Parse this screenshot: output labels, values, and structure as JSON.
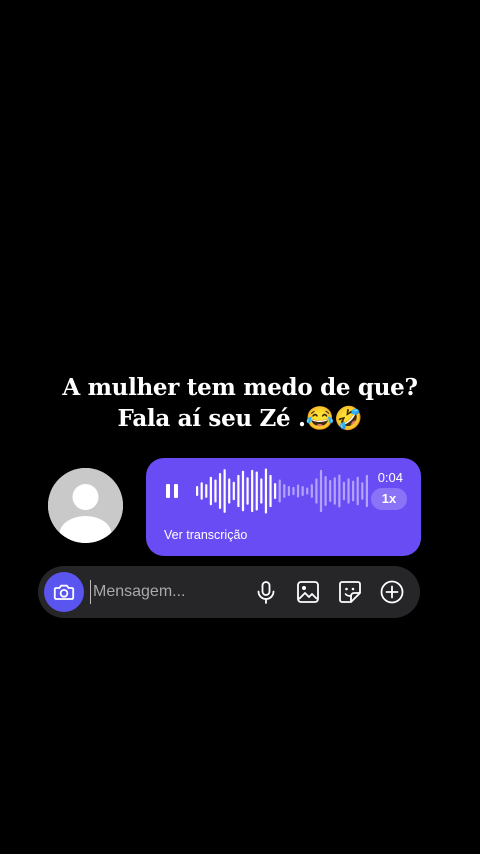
{
  "caption": {
    "line1": "A mulher tem medo de que?",
    "line2": "Fala aí seu Zé .😂🤣"
  },
  "voice_message": {
    "duration": "0:04",
    "speed": "1x",
    "transcript_link": "Ver transcrição",
    "state": "playing",
    "waveform_levels": [
      0.22,
      0.38,
      0.3,
      0.62,
      0.5,
      0.78,
      0.95,
      0.55,
      0.4,
      0.7,
      0.88,
      0.6,
      0.92,
      0.85,
      0.55,
      0.98,
      0.7,
      0.35,
      0.5,
      0.3,
      0.22,
      0.18,
      0.28,
      0.22,
      0.15,
      0.3,
      0.55,
      0.92,
      0.65,
      0.48,
      0.6,
      0.72,
      0.4,
      0.55,
      0.45,
      0.62,
      0.38,
      0.7
    ],
    "played_count": 18,
    "colors": {
      "bubble": "#6a4cf5",
      "played_bar": "#ffffff",
      "unplayed_bar": "#b3a3fb"
    }
  },
  "composer": {
    "placeholder": "Mensagem...",
    "icons": [
      "camera-icon",
      "microphone-icon",
      "gallery-icon",
      "sticker-icon",
      "plus-icon"
    ],
    "accent": "#5b55f0"
  }
}
